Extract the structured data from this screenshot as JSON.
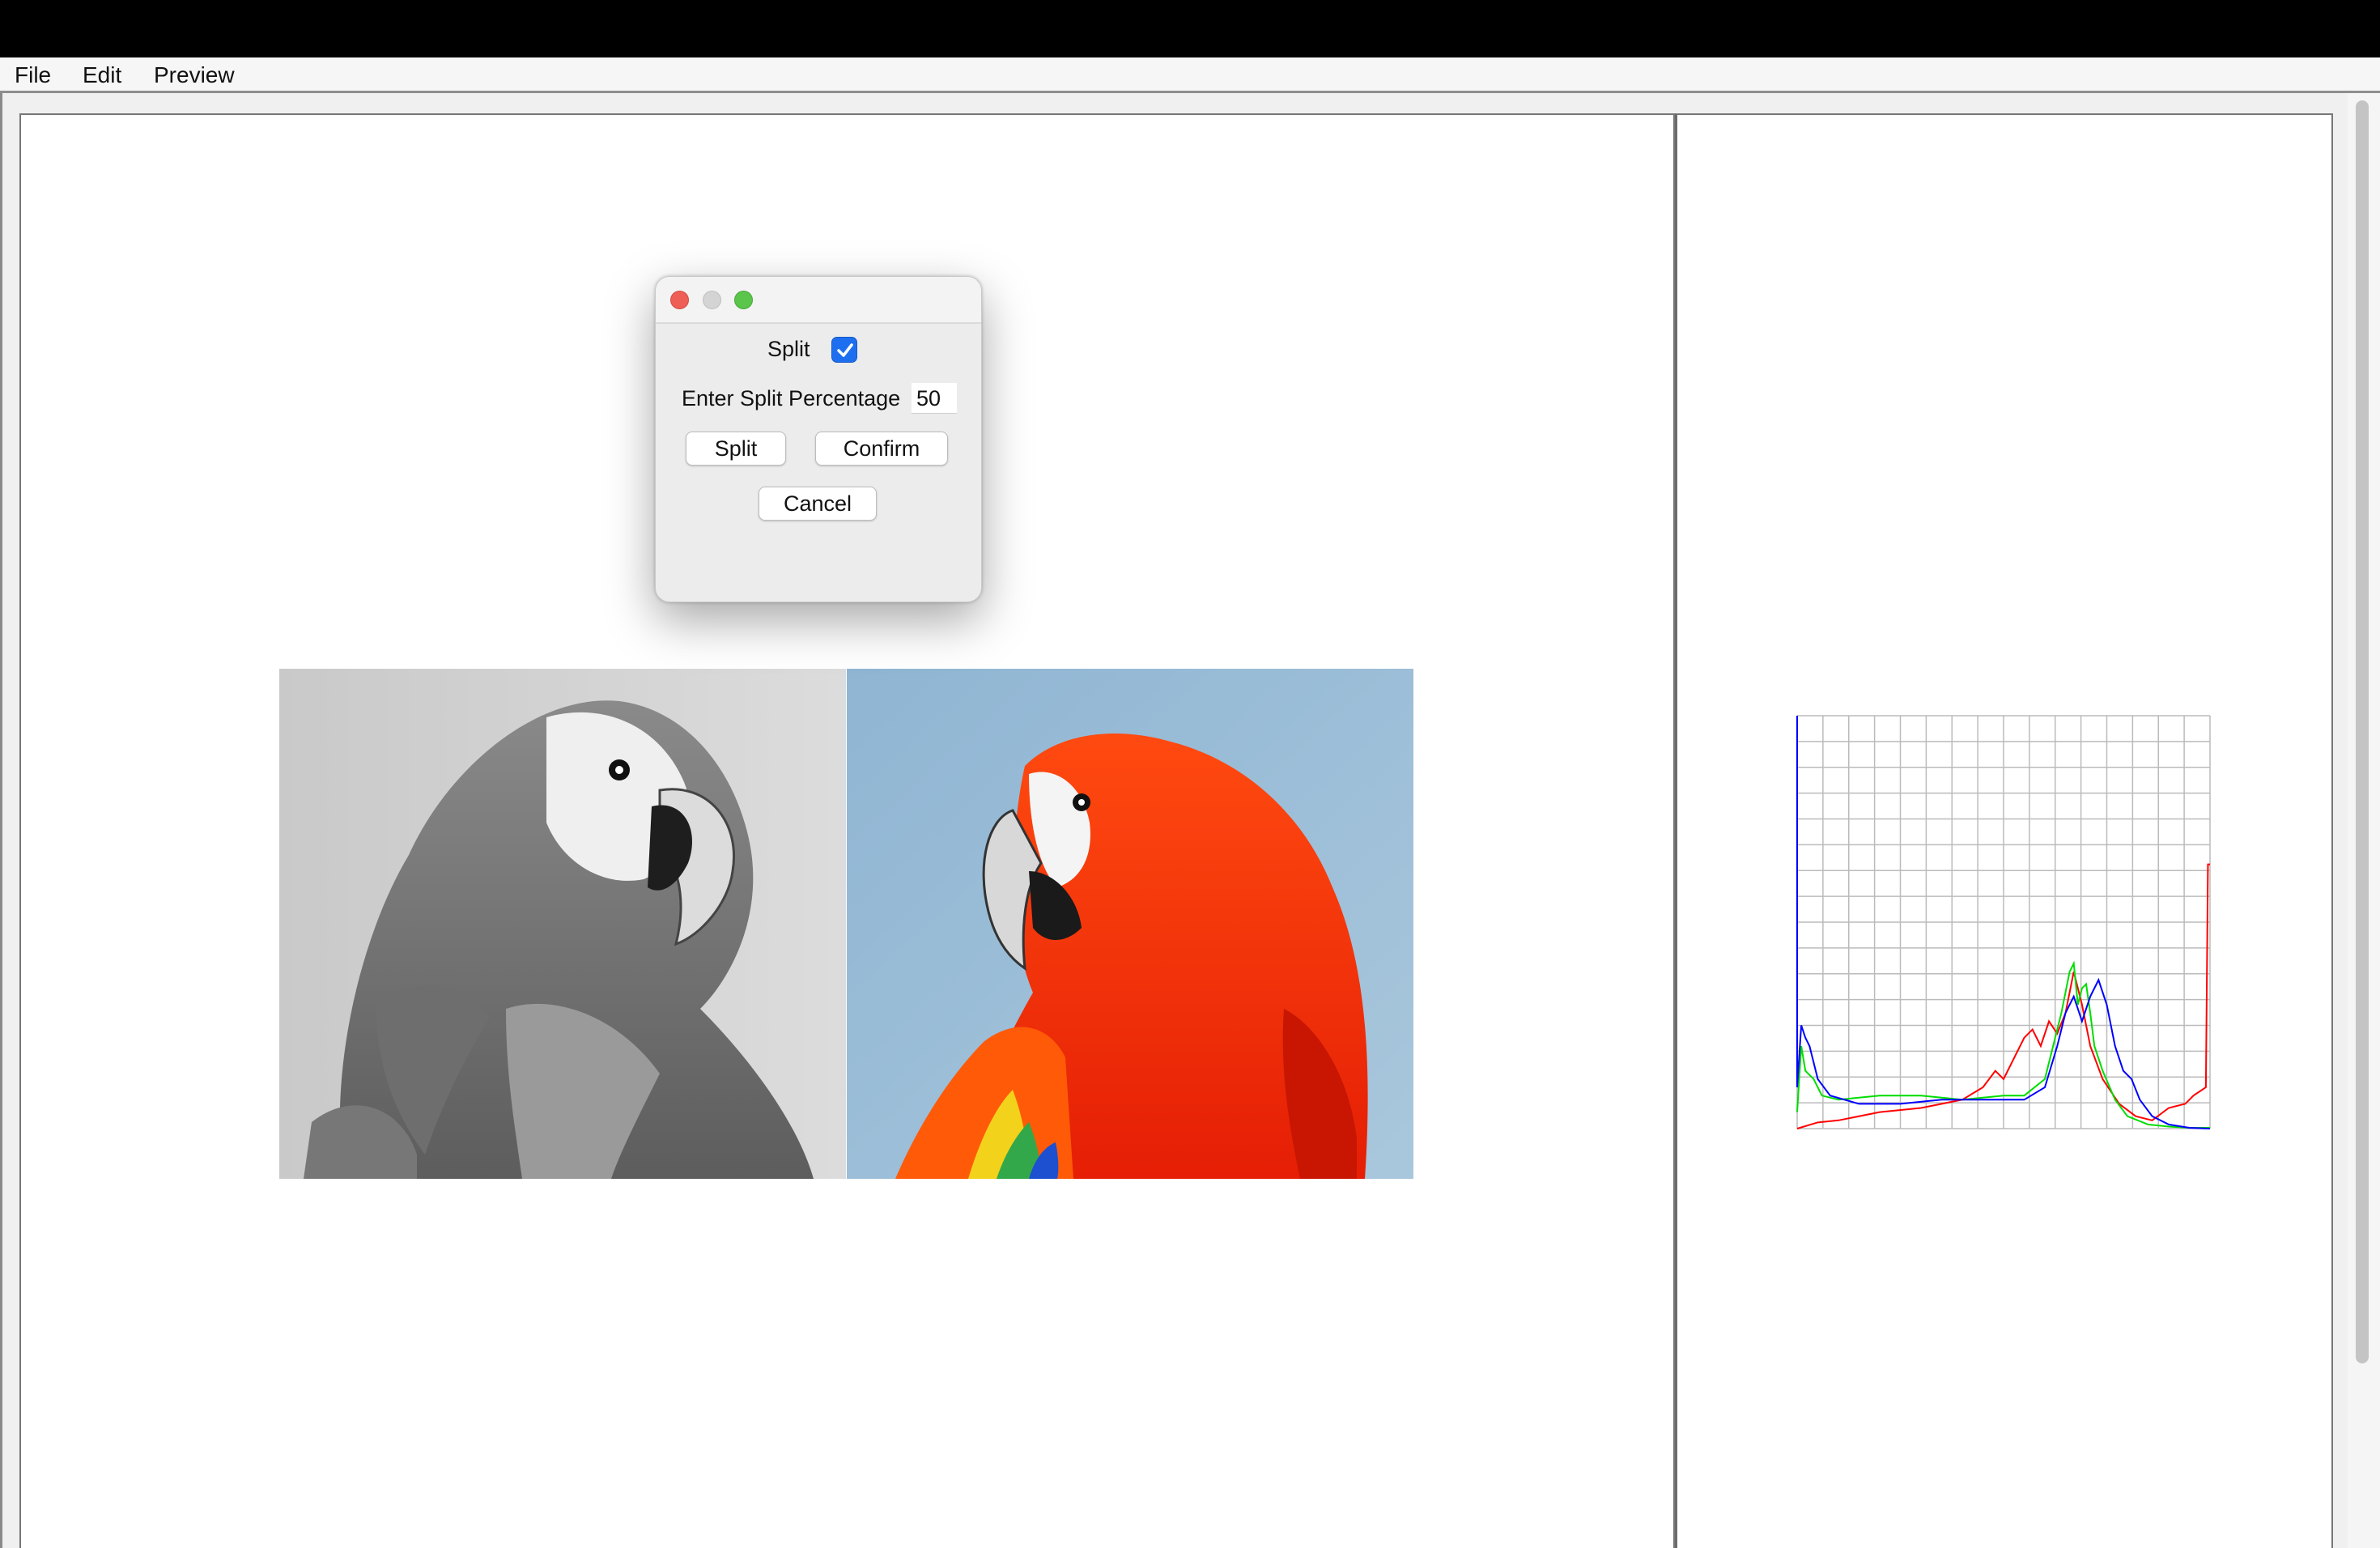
{
  "menubar": {
    "items": [
      "File",
      "Edit",
      "Preview"
    ]
  },
  "dialog": {
    "split_label": "Split",
    "split_checked": true,
    "percentage_label": "Enter Split Percentage",
    "percentage_value": "50",
    "split_button": "Split",
    "confirm_button": "Confirm",
    "cancel_button": "Cancel"
  },
  "preview": {
    "split_fraction": 0.5
  },
  "histogram": {
    "colors": {
      "red": "#ff0000",
      "green": "#00dd00",
      "blue": "#0000ff",
      "grid": "#bbbbbb"
    }
  }
}
